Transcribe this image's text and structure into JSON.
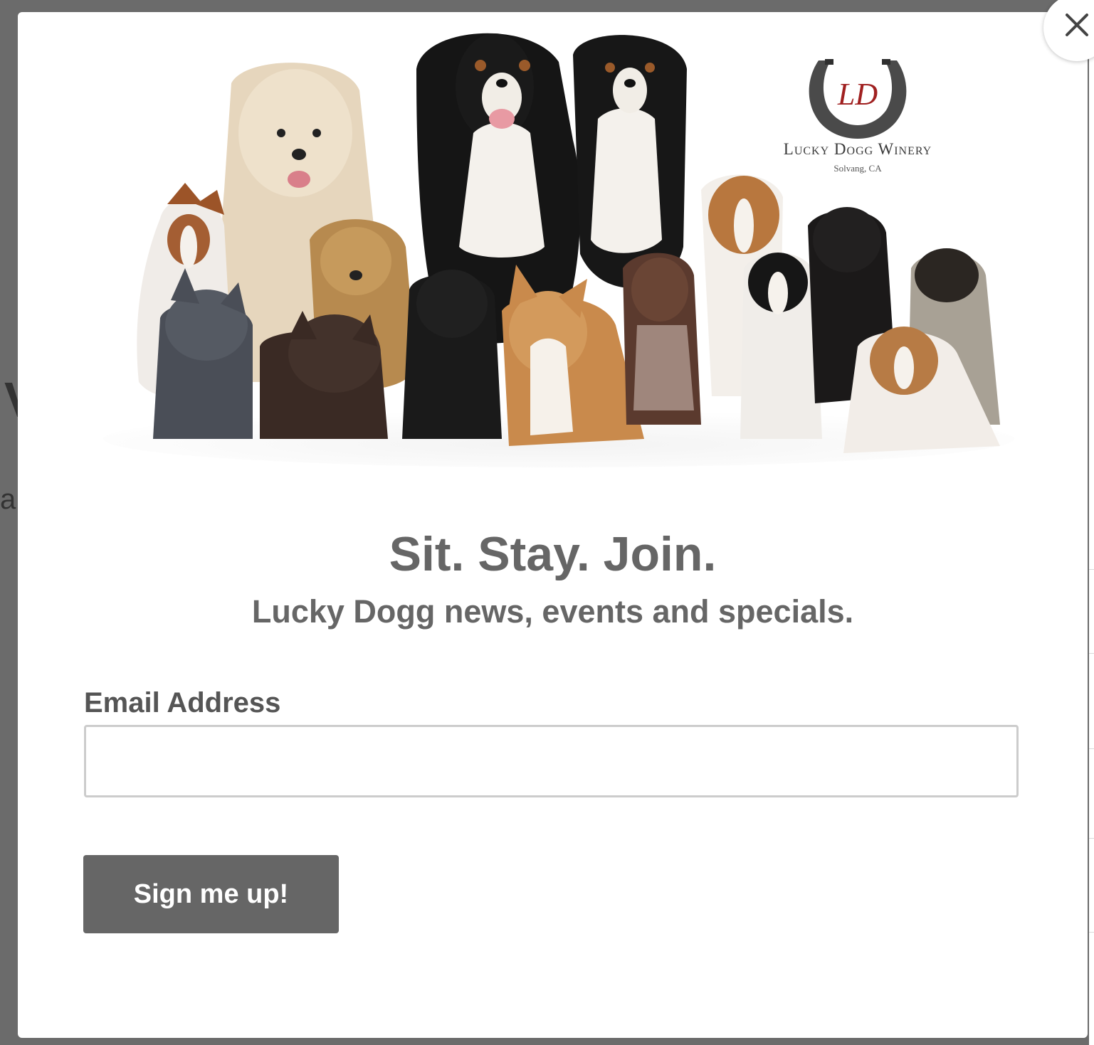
{
  "background_page": {
    "fragment_1": "V",
    "fragment_2": "a"
  },
  "modal": {
    "close_icon": "close-icon",
    "hero": {
      "logo": {
        "monogram": "LD",
        "name": "Lucky Dogg Winery",
        "location": "Solvang, CA"
      }
    },
    "headline": "Sit. Stay. Join.",
    "subheadline": "Lucky Dogg news, events and specials.",
    "form": {
      "email_label": "Email Address",
      "email_value": "",
      "email_placeholder": "",
      "submit_label": "Sign me up!"
    }
  },
  "colors": {
    "overlay": "#6b6b6b",
    "text_gray": "#666666",
    "button": "#666666",
    "button_text": "#ffffff",
    "logo_red": "#a02020"
  }
}
